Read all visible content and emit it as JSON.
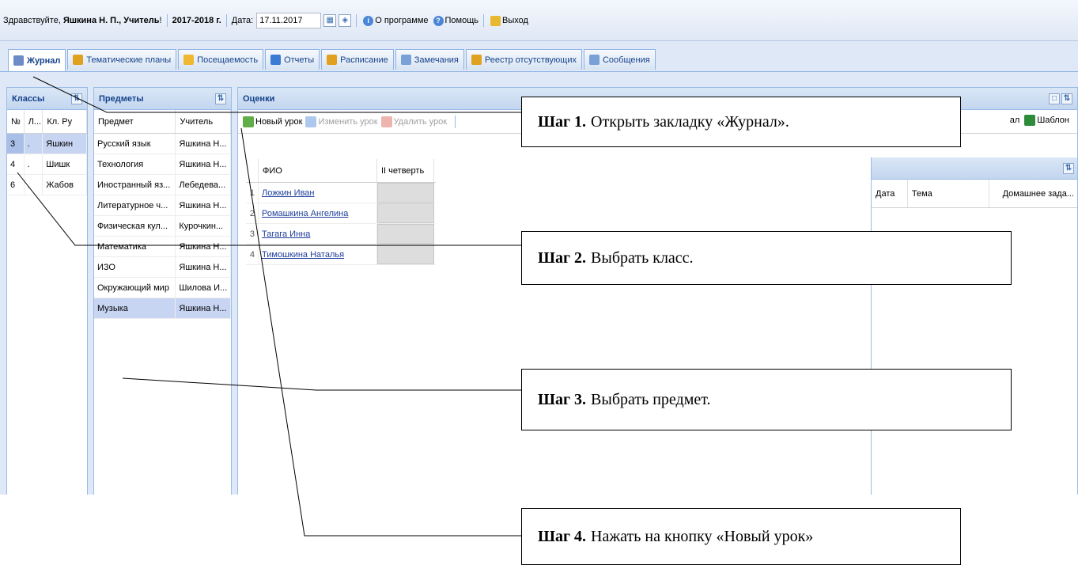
{
  "header": {
    "greeting": "Здравствуйте,",
    "user": "Яшкина Н. П., Учитель",
    "exclaim": "!",
    "year": "2017-2018 г.",
    "date_label": "Дата:",
    "date_value": "17.11.2017",
    "about": "О программе",
    "help": "Помощь",
    "logout": "Выход"
  },
  "tabs": [
    {
      "label": "Журнал",
      "color": "#6b8cc7"
    },
    {
      "label": "Тематические планы",
      "color": "#e0a020"
    },
    {
      "label": "Посещаемость",
      "color": "#f0b830"
    },
    {
      "label": "Отчеты",
      "color": "#3b7bd4"
    },
    {
      "label": "Расписание",
      "color": "#e0a020"
    },
    {
      "label": "Замечания",
      "color": "#7aa0d8"
    },
    {
      "label": "Реестр отсутствующих",
      "color": "#e0a020"
    },
    {
      "label": "Сообщения",
      "color": "#7aa0d8"
    }
  ],
  "classes": {
    "title": "Классы",
    "columns": [
      "№",
      "Л...",
      "Кл. Ру"
    ],
    "rows": [
      {
        "num": "3",
        "letter": ".",
        "teacher": "Яшкин"
      },
      {
        "num": "4",
        "letter": ".",
        "teacher": "Шишк"
      },
      {
        "num": "6",
        "letter": ".",
        "teacher": "Жабов"
      }
    ]
  },
  "subjects": {
    "title": "Предметы",
    "columns": [
      "Предмет",
      "Учитель"
    ],
    "rows": [
      {
        "subject": "Русский язык",
        "teacher": "Яшкина Н..."
      },
      {
        "subject": "Технология",
        "teacher": "Яшкина Н..."
      },
      {
        "subject": "Иностранный яз...",
        "teacher": "Лебедева..."
      },
      {
        "subject": "Литературное ч...",
        "teacher": "Яшкина Н..."
      },
      {
        "subject": "Физическая кул...",
        "teacher": "Курочкин..."
      },
      {
        "subject": "Математика",
        "teacher": "Яшкина Н..."
      },
      {
        "subject": "ИЗО",
        "teacher": "Яшкина Н..."
      },
      {
        "subject": "Окружающий мир",
        "teacher": "Шилова И..."
      },
      {
        "subject": "Музыка",
        "teacher": "Яшкина Н..."
      }
    ]
  },
  "grades": {
    "title": "Оценки",
    "new_lesson": "Новый урок",
    "edit_lesson": "Изменить урок",
    "delete_lesson": "Удалить урок",
    "col_fio": "ФИО",
    "col_quarter": "II четверть",
    "students": [
      {
        "n": "1",
        "name": "Ложкин Иван"
      },
      {
        "n": "2",
        "name": "Ромашкина Ангелина"
      },
      {
        "n": "3",
        "name": "Тагага Инна"
      },
      {
        "n": "4",
        "name": "Тимошкина Наталья"
      }
    ],
    "journal_tail": "ал",
    "template": "Шаблон"
  },
  "lessons": {
    "columns": [
      "Дата",
      "Тема",
      "Домашнее зада..."
    ]
  },
  "steps": [
    {
      "label": "Шаг 1.",
      "text": "Открыть закладку «Журнал»."
    },
    {
      "label": "Шаг 2.",
      "text": "Выбрать класс."
    },
    {
      "label": "Шаг 3.",
      "text": "Выбрать предмет."
    },
    {
      "label": "Шаг 4.",
      "text": "Нажать на кнопку «Новый урок»"
    }
  ]
}
